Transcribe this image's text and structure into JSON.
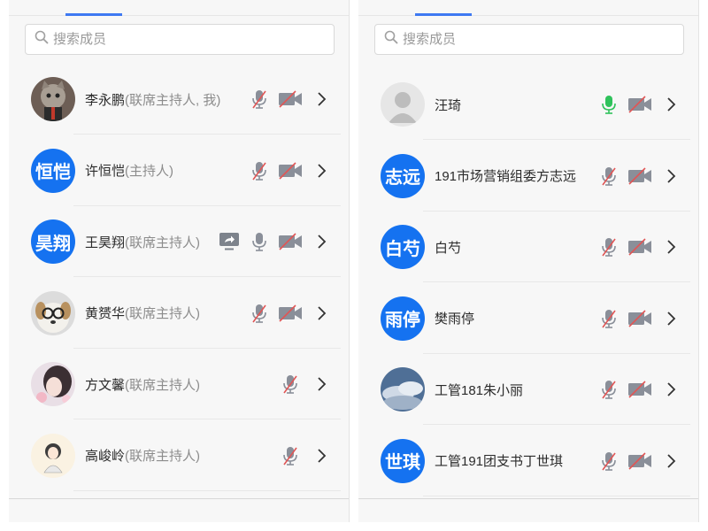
{
  "left_panel": {
    "search_placeholder": "搜索成员",
    "members": [
      {
        "name": "李永鹏",
        "role": "(联席主持人, 我)",
        "avatar_text": "",
        "avatar_kind": "cat-photo",
        "share": false,
        "mic": "muted",
        "camera": "off"
      },
      {
        "name": "许恒恺",
        "role": "(主持人)",
        "avatar_text": "恒恺",
        "avatar_kind": "text",
        "share": false,
        "mic": "muted",
        "camera": "off"
      },
      {
        "name": "王昊翔",
        "role": "(联席主持人)",
        "avatar_text": "昊翔",
        "avatar_kind": "text",
        "share": true,
        "mic": "on",
        "camera": "off"
      },
      {
        "name": "黄赟华",
        "role": "(联席主持人)",
        "avatar_text": "",
        "avatar_kind": "dog-photo",
        "share": false,
        "mic": "muted",
        "camera": "off"
      },
      {
        "name": "方文馨",
        "role": "(联席主持人)",
        "avatar_text": "",
        "avatar_kind": "girl-photo",
        "share": false,
        "mic": "muted",
        "camera": "none"
      },
      {
        "name": "高峻岭",
        "role": "(联席主持人)",
        "avatar_text": "",
        "avatar_kind": "drawing-photo",
        "share": false,
        "mic": "muted",
        "camera": "none"
      }
    ]
  },
  "right_panel": {
    "search_placeholder": "搜索成员",
    "members": [
      {
        "name": "汪琦",
        "role": "",
        "avatar_text": "",
        "avatar_kind": "default-person",
        "share": false,
        "mic": "speaking",
        "camera": "off"
      },
      {
        "name": "191市场营销组委方志远",
        "role": "",
        "avatar_text": "志远",
        "avatar_kind": "text",
        "share": false,
        "mic": "muted",
        "camera": "off"
      },
      {
        "name": "白芍",
        "role": "",
        "avatar_text": "白芍",
        "avatar_kind": "text",
        "share": false,
        "mic": "muted",
        "camera": "off"
      },
      {
        "name": "樊雨停",
        "role": "",
        "avatar_text": "雨停",
        "avatar_kind": "text",
        "share": false,
        "mic": "muted",
        "camera": "off"
      },
      {
        "name": "工管181朱小丽",
        "role": "",
        "avatar_text": "",
        "avatar_kind": "sky-photo",
        "share": false,
        "mic": "muted",
        "camera": "off"
      },
      {
        "name": "工管191团支书丁世琪",
        "role": "",
        "avatar_text": "世琪",
        "avatar_kind": "text",
        "share": false,
        "mic": "muted",
        "camera": "off"
      }
    ]
  },
  "colors": {
    "accent": "#1572f0",
    "tab_underline": "#3e79f2",
    "muted_slash": "#e05555",
    "icon_gray": "#8a8f99",
    "speaking_green": "#2fc25b"
  }
}
